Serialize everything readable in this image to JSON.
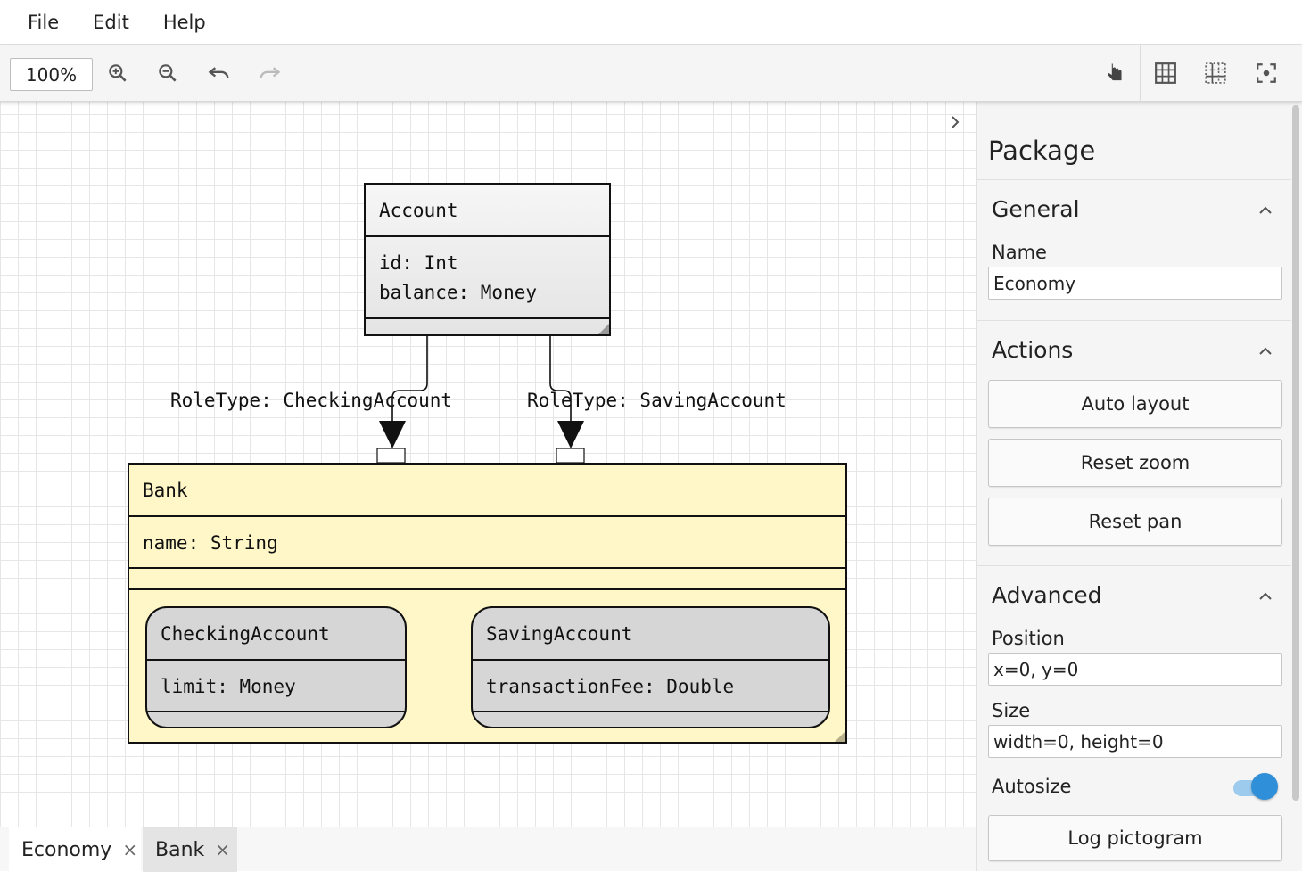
{
  "menu": {
    "file": "File",
    "edit": "Edit",
    "help": "Help"
  },
  "toolbar": {
    "zoom_value": "100%",
    "icons": [
      "zoom-in-icon",
      "zoom-out-icon",
      "undo-icon",
      "redo-icon",
      "pan-hand-icon",
      "grid-icon",
      "snap-grid-icon",
      "fit-screen-icon"
    ]
  },
  "diagram": {
    "account": {
      "name": "Account",
      "attr1": "id: Int",
      "attr2": "balance: Money"
    },
    "bank": {
      "name": "Bank",
      "attr1": "name: String"
    },
    "checking": {
      "name": "CheckingAccount",
      "attr1": "limit: Money"
    },
    "saving": {
      "name": "SavingAccount",
      "attr1": "transactionFee: Double"
    },
    "role_checking": "RoleType: CheckingAccount",
    "role_saving": "RoleType: SavingAccount",
    "colors": {
      "bank_fill": "#fff7c8",
      "class_fill": "#ececec",
      "role_fill": "#d6d6d6"
    }
  },
  "panel": {
    "title": "Package",
    "general": {
      "title": "General",
      "name_label": "Name",
      "name_value": "Economy"
    },
    "actions": {
      "title": "Actions",
      "auto_layout": "Auto layout",
      "reset_zoom": "Reset zoom",
      "reset_pan": "Reset pan"
    },
    "advanced": {
      "title": "Advanced",
      "position_label": "Position",
      "position_value": "x=0, y=0",
      "size_label": "Size",
      "size_value": "width=0, height=0",
      "autosize_label": "Autosize",
      "autosize_on": true,
      "log_pictogram": "Log pictogram"
    },
    "toggle_color": "#2f8fd8"
  },
  "tabs": [
    {
      "label": "Economy",
      "close": "×"
    },
    {
      "label": "Bank",
      "close": "×"
    }
  ]
}
